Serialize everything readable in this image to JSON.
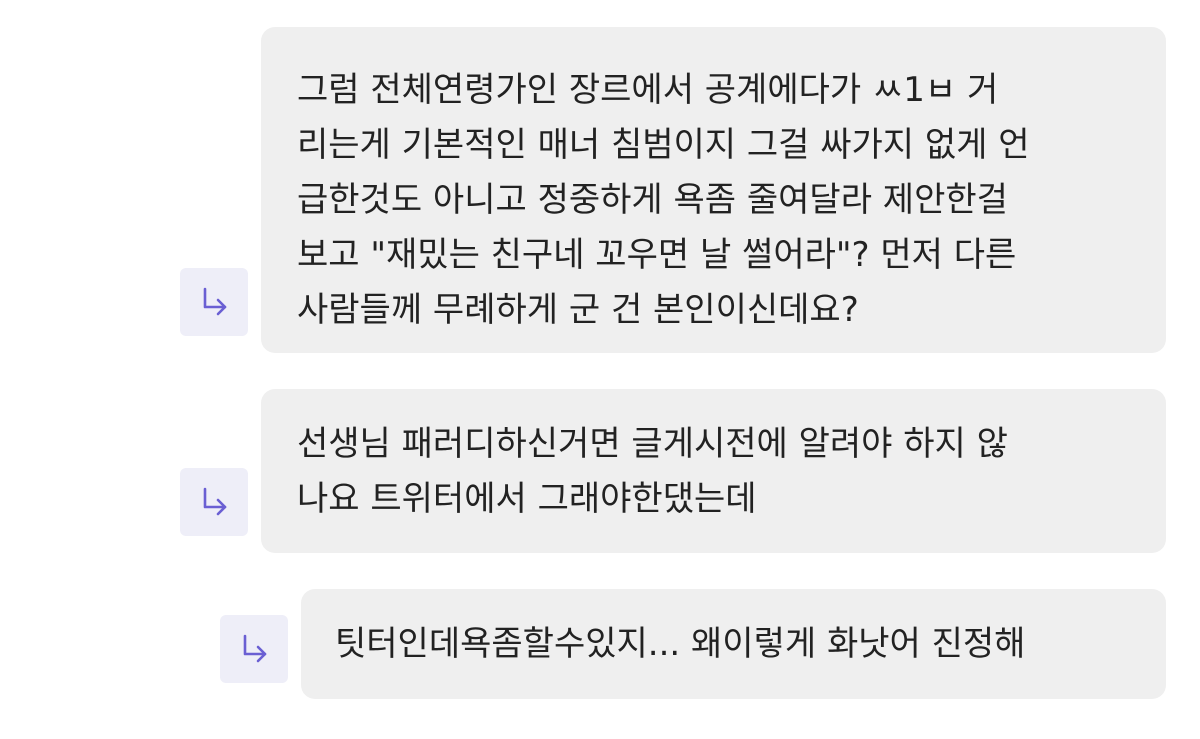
{
  "colors": {
    "bubble_bg": "#efefef",
    "icon_bg": "#eeeef8",
    "icon_stroke": "#6a5fd3",
    "text": "#222222"
  },
  "icons": {
    "reply": "reply-arrow-icon"
  },
  "replies": [
    {
      "lines": [
        "그럼 전체연령가인 장르에서 공계에다가 ㅆ1ㅂ 거",
        "리는게 기본적인 매너 침범이지 그걸 싸가지 없게 언",
        "급한것도 아니고 정중하게 욕좀 줄여달라 제안한걸",
        "보고 \"재밌는 친구네 꼬우면 날 썰어라\"? 먼저 다른",
        "사람들께 무례하게 군 건 본인이신데요?"
      ]
    },
    {
      "lines": [
        "선생님 패러디하신거면 글게시전에 알려야 하지 않",
        "나요 트위터에서 그래야한댔는데"
      ]
    },
    {
      "lines": [
        "팃터인데욕좀할수있지... 왜이렇게 화낫어 진정해"
      ]
    }
  ]
}
